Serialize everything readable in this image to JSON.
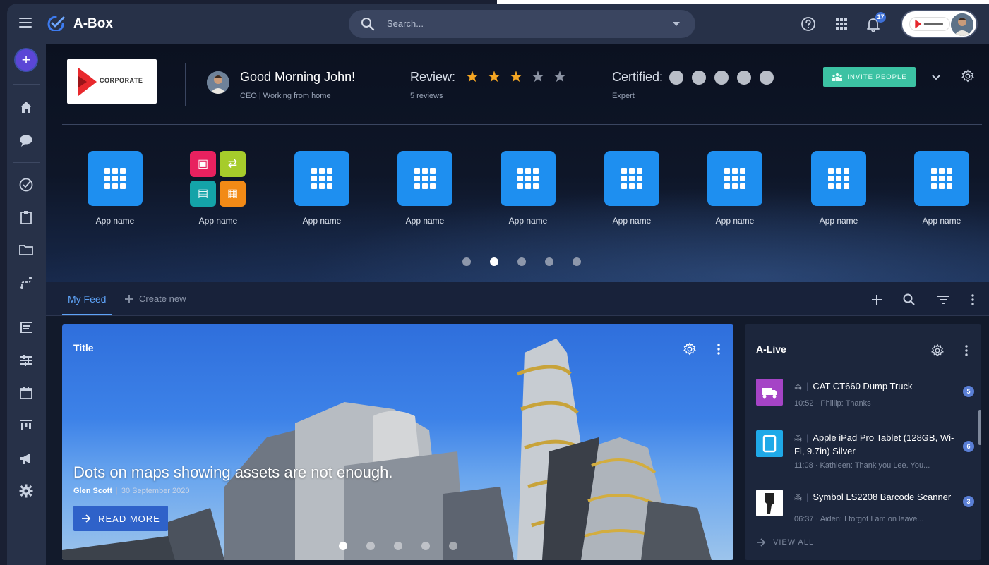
{
  "app": {
    "title": "A-Box"
  },
  "search": {
    "placeholder": "Search..."
  },
  "notifications": {
    "count": "17"
  },
  "header": {
    "company_logo_text": "CORPORATE",
    "greeting": "Good Morning John!",
    "role": "CEO | Working from home",
    "review_label": "Review:",
    "review_count": "5 reviews",
    "review_stars": 3,
    "review_max": 5,
    "certified_label": "Certified:",
    "certified_level": "Expert",
    "certified_dots": 5,
    "invite_label": "INVITE PEOPLE"
  },
  "apps": [
    {
      "label": "App name",
      "icon": "grid-icon"
    },
    {
      "label": "App name",
      "icon": "multi-app-icon"
    },
    {
      "label": "App name",
      "icon": "grid-icon"
    },
    {
      "label": "App name",
      "icon": "grid-icon"
    },
    {
      "label": "App name",
      "icon": "grid-icon"
    },
    {
      "label": "App name",
      "icon": "grid-icon"
    },
    {
      "label": "App name",
      "icon": "grid-icon"
    },
    {
      "label": "App name",
      "icon": "grid-icon"
    },
    {
      "label": "App name",
      "icon": "grid-icon"
    }
  ],
  "apps_pager": {
    "pages": 5,
    "active": 2
  },
  "feed": {
    "tab_active": "My Feed",
    "tab_create": "Create new"
  },
  "main_card": {
    "title": "Title",
    "headline": "Dots on maps showing assets are not enough.",
    "author": "Glen Scott",
    "date": "30 September 2020",
    "cta": "READ MORE",
    "pages": 5,
    "active_page": 1
  },
  "alive": {
    "title": "A-Live",
    "items": [
      {
        "name": "CAT CT660 Dump Truck",
        "time": "10:52",
        "snippet": "Phillip: Thanks",
        "count": "5",
        "thumb_color": "#a544c6",
        "icon": "truck-icon"
      },
      {
        "name": "Apple iPad Pro Tablet (128GB, Wi-Fi, 9.7in) Silver",
        "time": "11:08",
        "snippet": "Kathleen: Thank you Lee. You...",
        "count": "6",
        "thumb_color": "#1fa9e8",
        "icon": "tablet-icon"
      },
      {
        "name": "Symbol LS2208 Barcode Scanner",
        "time": "06:37",
        "snippet": "Aiden: I forgot I am on leave...",
        "count": "3",
        "thumb_color": "#ffffff",
        "icon": "scanner-icon"
      }
    ],
    "view_all": "VIEW ALL"
  },
  "colors": {
    "accent": "#1e8ff0",
    "invite": "#3cc2a3",
    "star_on": "#f5a623",
    "star_off": "#8c93a3",
    "tab_active": "#5ea3f7"
  }
}
